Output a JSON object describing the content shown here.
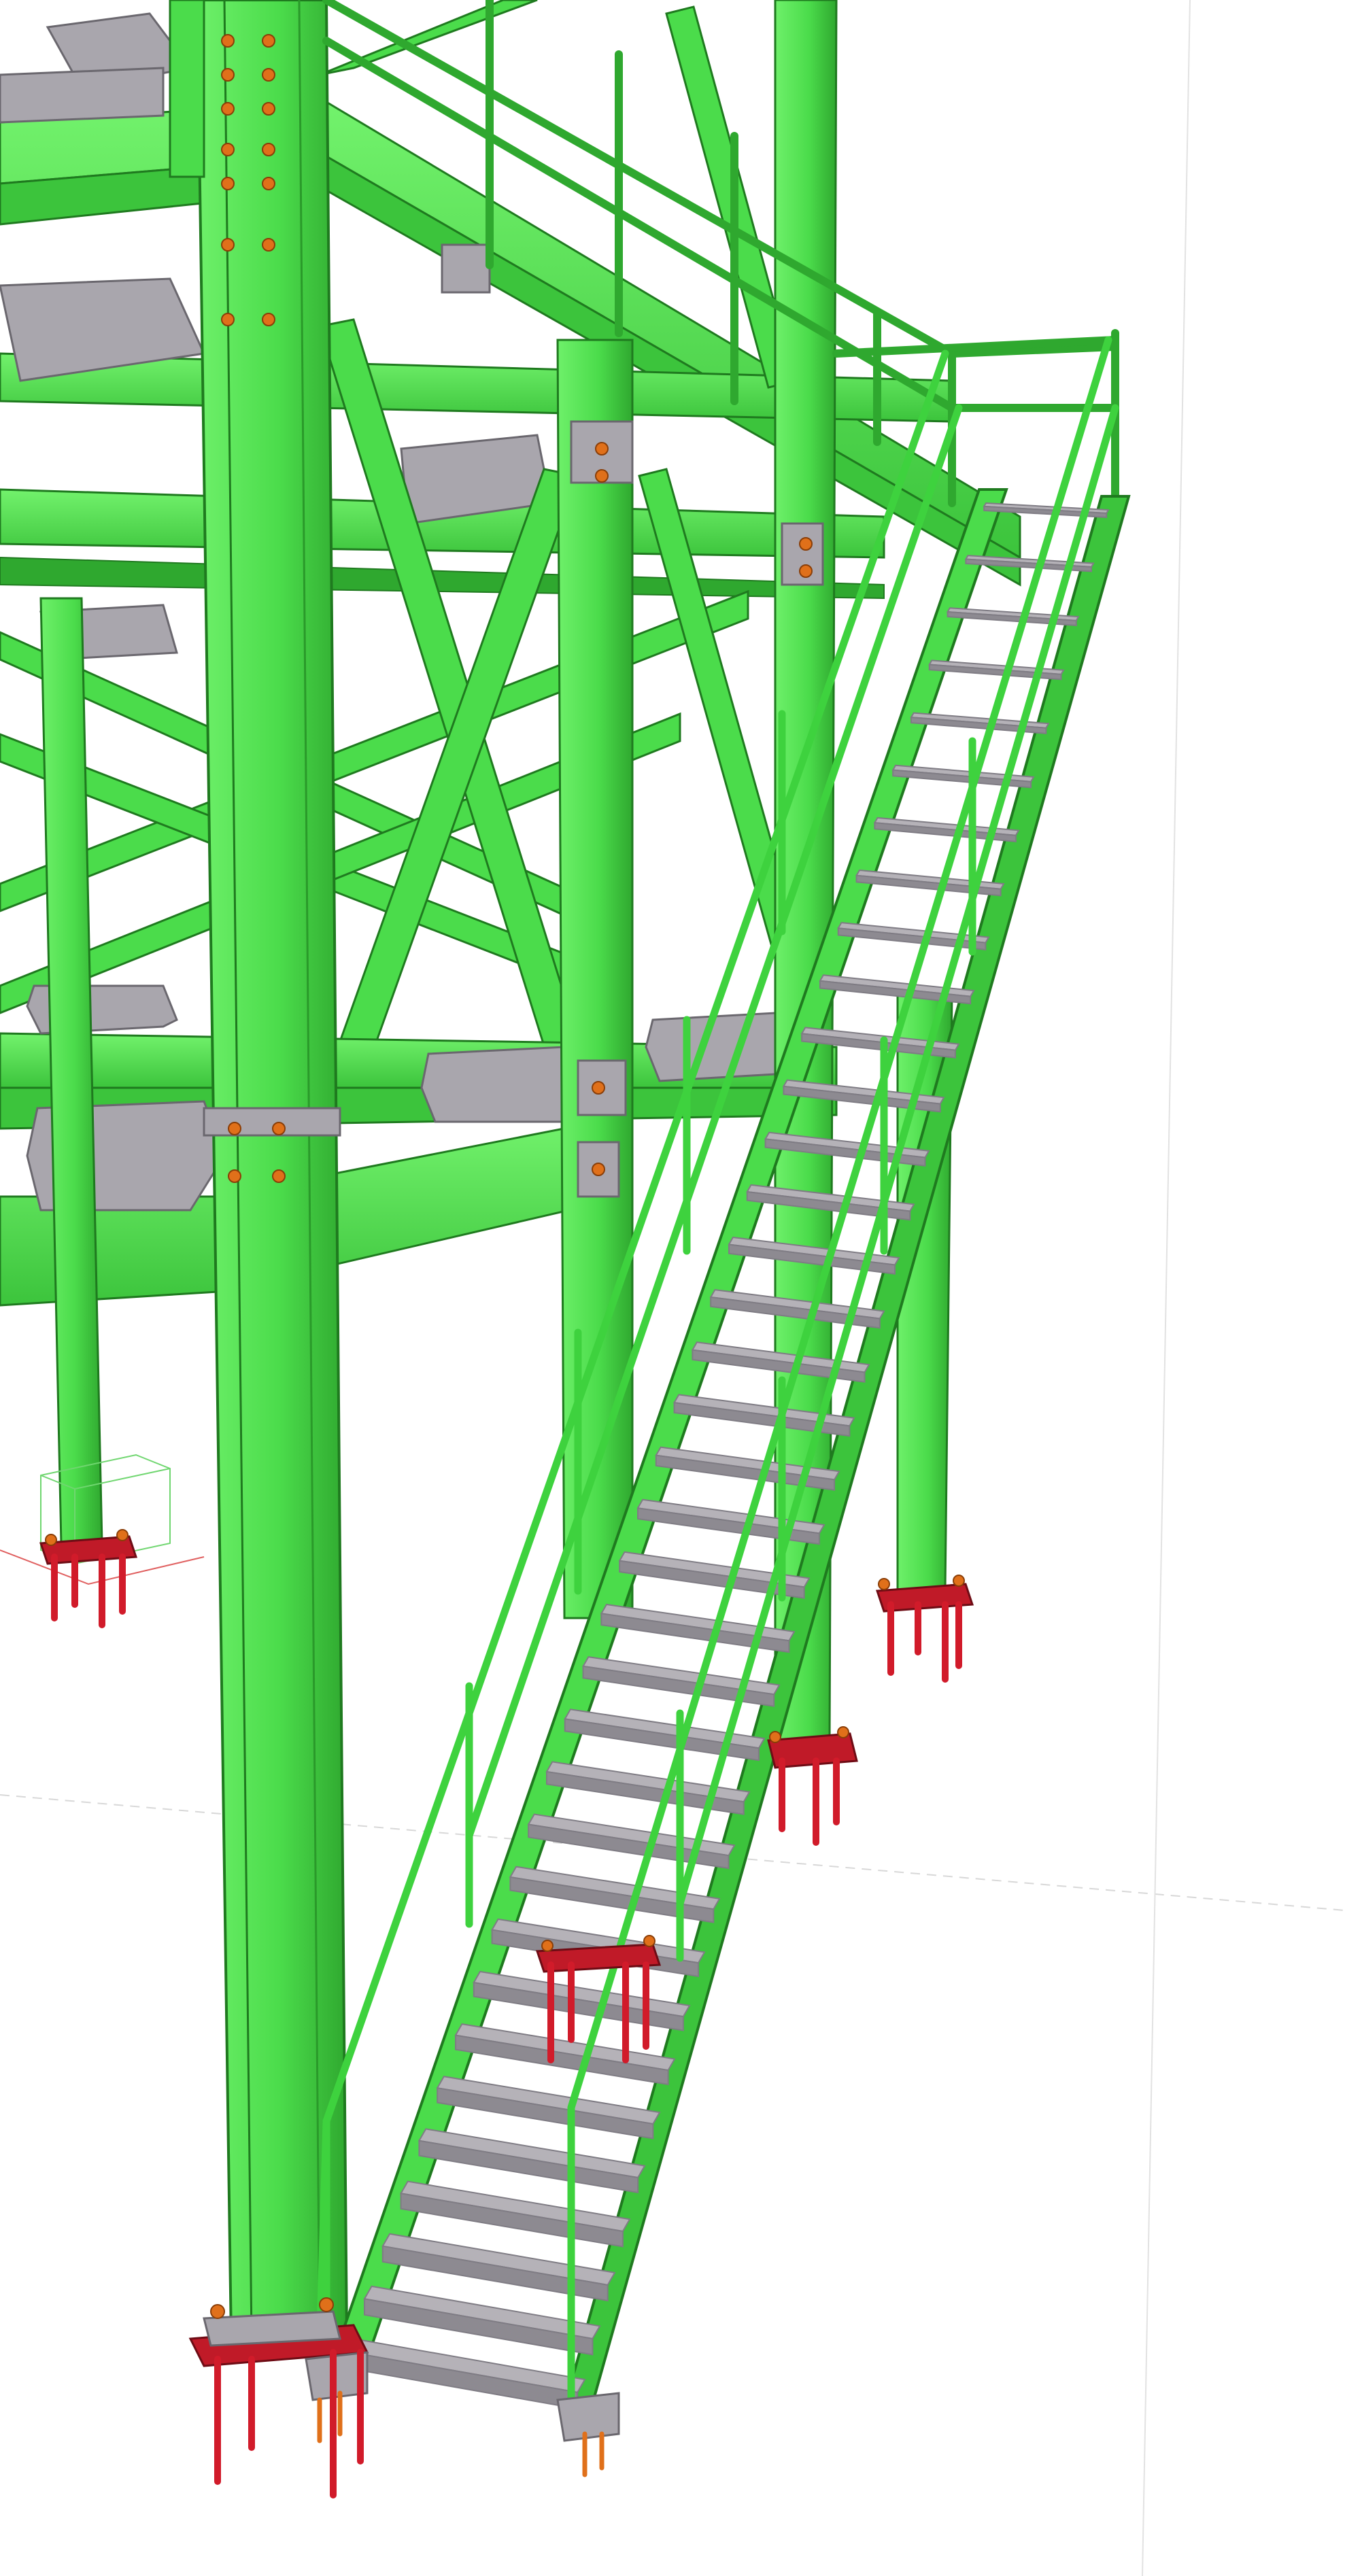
{
  "viewport": {
    "background": "#ffffff",
    "view": "3d-model-view"
  },
  "colors": {
    "steel": "#4bdc4b",
    "steel_light": "#6ef06a",
    "steel_dark": "#2fa82f",
    "steel_edge": "#1f7a1f",
    "plate": "#a9a6ad",
    "plate_dark": "#7f7c84",
    "tread": "#8d8a91",
    "tread_top": "#b5b2b8",
    "bolt": "#e0701a",
    "anchor": "#d11b2a",
    "baseplate": "#c01a28",
    "selection_box": "#6fd66f",
    "grid_line": "#d8d8d8"
  },
  "icons": {
    "bolt": "bolt-icon",
    "anchor": "anchor-rod-icon"
  },
  "model": {
    "stair_tread_count": 36
  }
}
